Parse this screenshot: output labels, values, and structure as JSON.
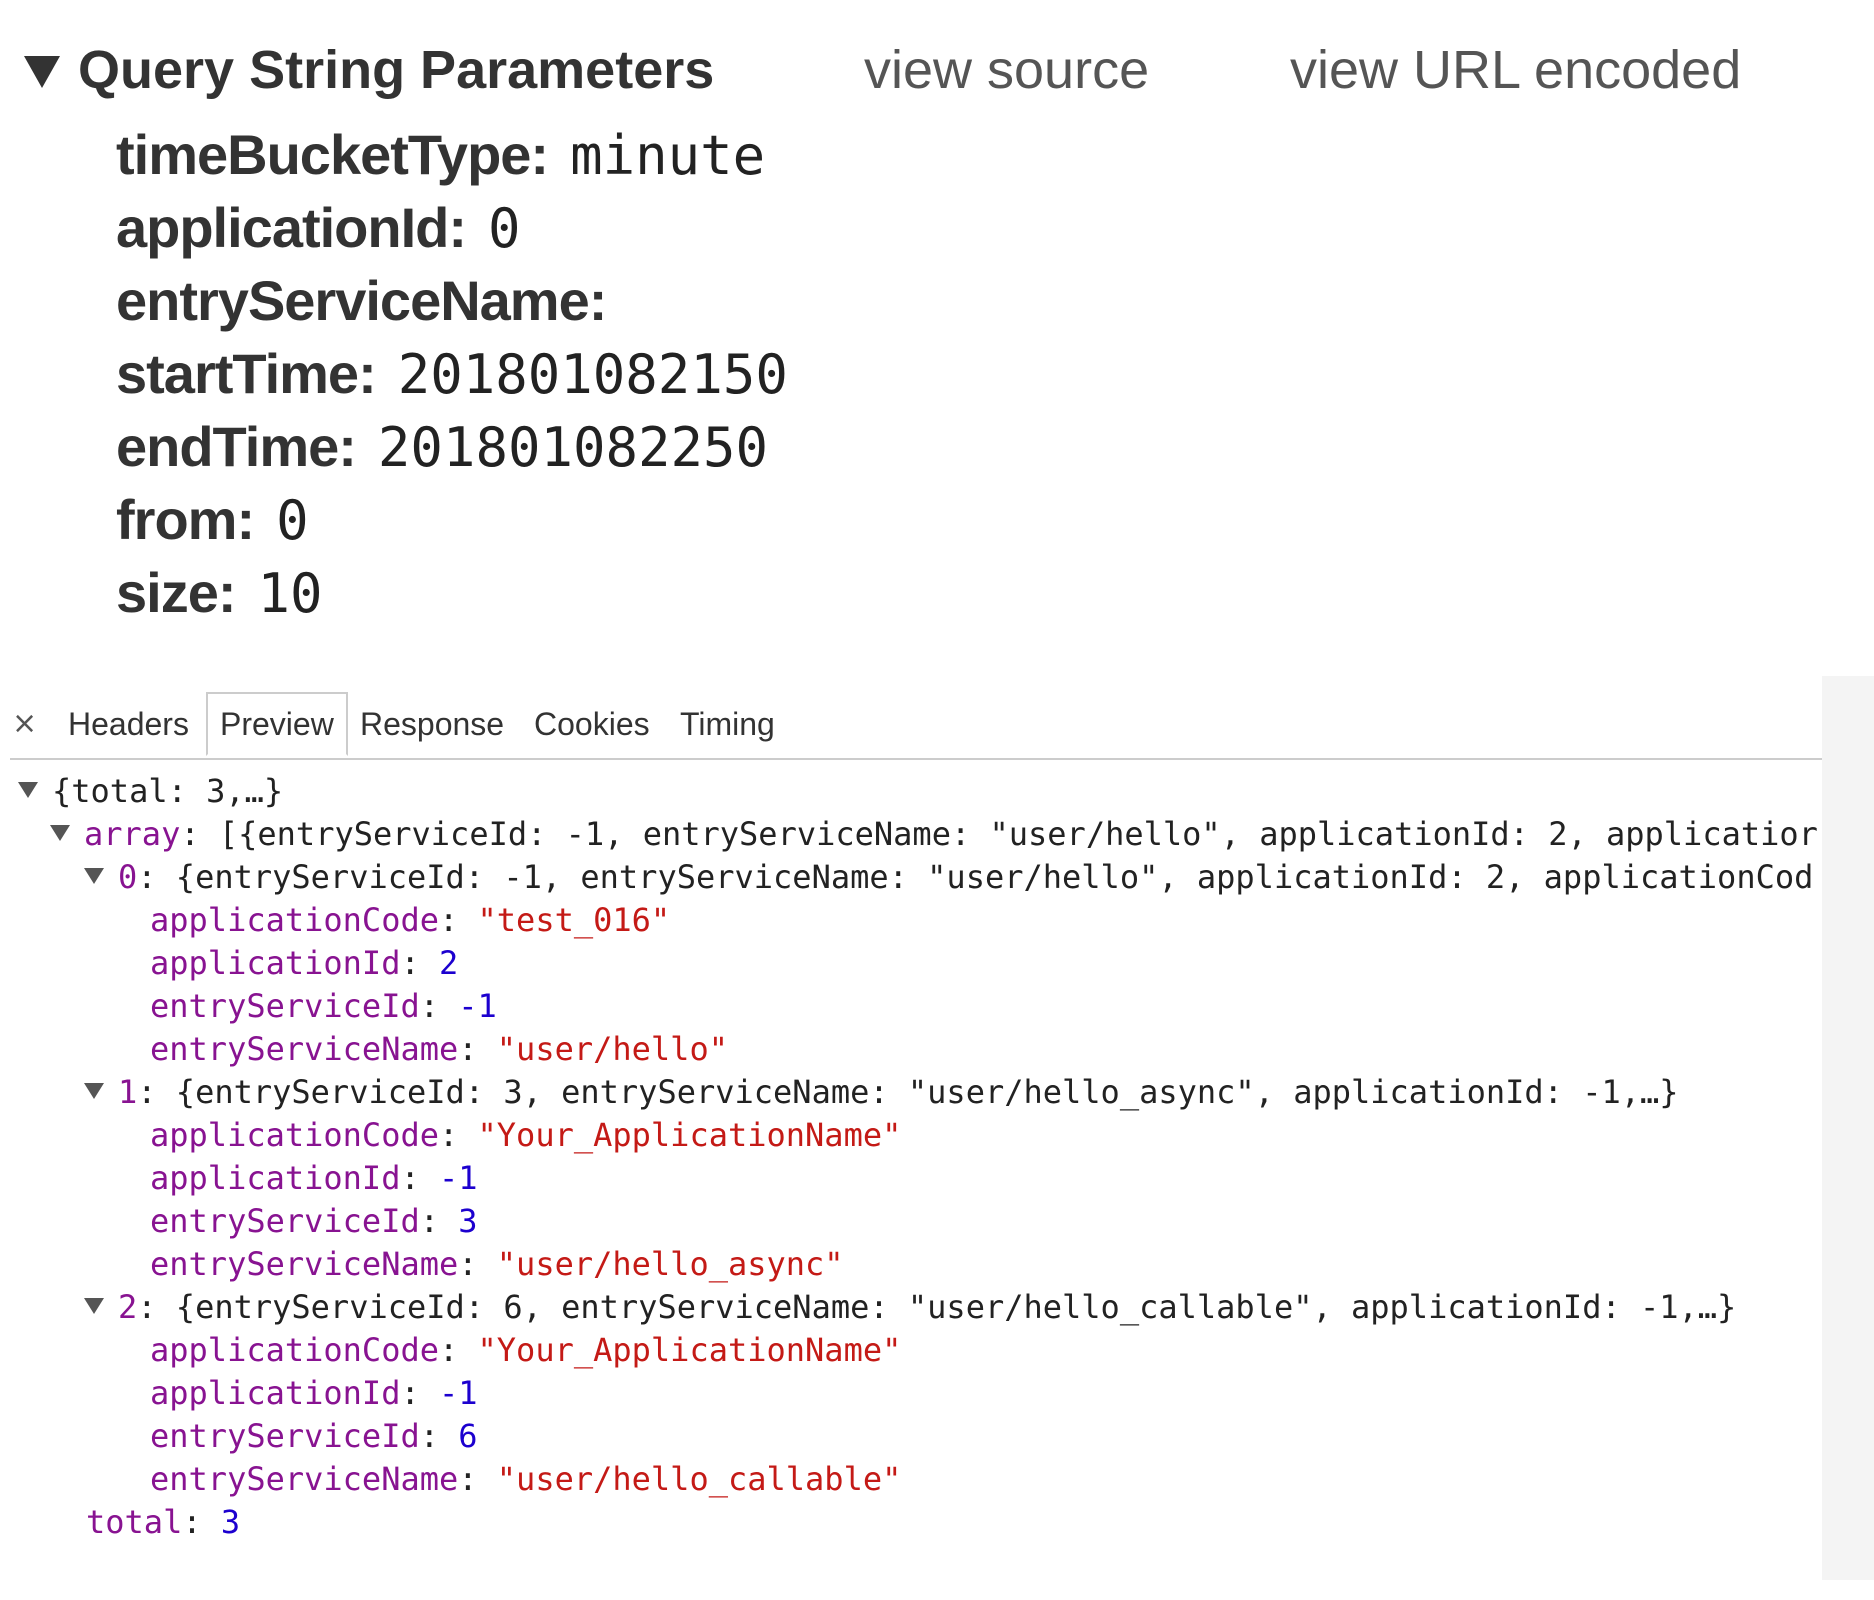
{
  "query_string": {
    "title": "Query String Parameters",
    "view_source_label": "view source",
    "view_url_encoded_label": "view URL encoded",
    "params": [
      {
        "key": "timeBucketType:",
        "value": "minute"
      },
      {
        "key": "applicationId:",
        "value": "0"
      },
      {
        "key": "entryServiceName:",
        "value": ""
      },
      {
        "key": "startTime:",
        "value": "201801082150"
      },
      {
        "key": "endTime:",
        "value": "201801082250"
      },
      {
        "key": "from:",
        "value": "0"
      },
      {
        "key": "size:",
        "value": "10"
      }
    ]
  },
  "tabs": {
    "close": "×",
    "headers": "Headers",
    "preview": "Preview",
    "response": "Response",
    "cookies": "Cookies",
    "timing": "Timing",
    "selected": "Preview"
  },
  "preview": {
    "root_summary": "{total: 3,…}",
    "array_key": "array",
    "array_summary": "[{entryServiceId: -1, entryServiceName: \"user/hello\", applicationId: 2, applicatior",
    "items": [
      {
        "index": "0",
        "summary": "{entryServiceId: -1, entryServiceName: \"user/hello\", applicationId: 2, applicationCod",
        "fields": [
          {
            "key": "applicationCode",
            "value": "\"test_016\"",
            "type": "string"
          },
          {
            "key": "applicationId",
            "value": "2",
            "type": "number"
          },
          {
            "key": "entryServiceId",
            "value": "-1",
            "type": "number"
          },
          {
            "key": "entryServiceName",
            "value": "\"user/hello\"",
            "type": "string"
          }
        ]
      },
      {
        "index": "1",
        "summary": "{entryServiceId: 3, entryServiceName: \"user/hello_async\", applicationId: -1,…}",
        "fields": [
          {
            "key": "applicationCode",
            "value": "\"Your_ApplicationName\"",
            "type": "string"
          },
          {
            "key": "applicationId",
            "value": "-1",
            "type": "number"
          },
          {
            "key": "entryServiceId",
            "value": "3",
            "type": "number"
          },
          {
            "key": "entryServiceName",
            "value": "\"user/hello_async\"",
            "type": "string"
          }
        ]
      },
      {
        "index": "2",
        "summary": "{entryServiceId: 6, entryServiceName: \"user/hello_callable\", applicationId: -1,…}",
        "fields": [
          {
            "key": "applicationCode",
            "value": "\"Your_ApplicationName\"",
            "type": "string"
          },
          {
            "key": "applicationId",
            "value": "-1",
            "type": "number"
          },
          {
            "key": "entryServiceId",
            "value": "6",
            "type": "number"
          },
          {
            "key": "entryServiceName",
            "value": "\"user/hello_callable\"",
            "type": "string"
          }
        ]
      }
    ],
    "total_key": "total",
    "total_value": "3"
  },
  "colors": {
    "key_purple": "#881391",
    "number_blue": "#1c00cf",
    "string_red": "#c41a16"
  }
}
